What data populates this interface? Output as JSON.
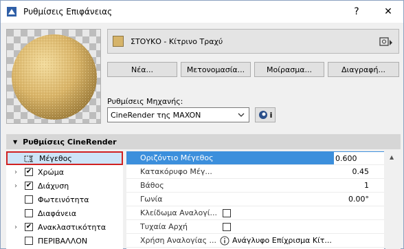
{
  "window": {
    "title": "Ρυθμίσεις Επιφάνειας",
    "help_label": "?",
    "close_label": "✕"
  },
  "material": {
    "name": "ΣΤΟΥΚΟ - Κίτρινο Τραχύ",
    "swatch_color": "#d6b46a"
  },
  "buttons": {
    "new": "Νέα...",
    "rename": "Μετονομασία...",
    "share": "Μοίρασμα...",
    "delete": "Διαγραφή..."
  },
  "engine": {
    "label": "Ρυθμίσεις Μηχανής:",
    "value": "CineRender της MAXON",
    "info_label": "i"
  },
  "section": {
    "title": "Ρυθμίσεις CineRender"
  },
  "channels": [
    {
      "label": "Μέγεθος",
      "checked": false,
      "expandable": false,
      "selected": true
    },
    {
      "label": "Χρώμα",
      "checked": true,
      "expandable": true
    },
    {
      "label": "Διάχυση",
      "checked": true,
      "expandable": true
    },
    {
      "label": "Φωτεινότητα",
      "checked": false,
      "expandable": false
    },
    {
      "label": "Διαφάνεια",
      "checked": false,
      "expandable": false
    },
    {
      "label": "Ανακλαστικότητα",
      "checked": true,
      "expandable": true
    },
    {
      "label": "ΠΕΡΙΒΑΛΛΟΝ",
      "checked": false,
      "expandable": false
    }
  ],
  "properties": [
    {
      "label": "Οριζόντιο Μέγεθος",
      "value": "0.600"
    },
    {
      "label": "Κατακόρυφο Μέγ...",
      "value": "0.45"
    },
    {
      "label": "Βάθος",
      "value": "1"
    },
    {
      "label": "Γωνία",
      "value": "0.00°"
    },
    {
      "label": "Κλείδωμα Αναλογί...",
      "value": ""
    },
    {
      "label": "Τυχαία Αρχή",
      "value": ""
    },
    {
      "label": "Χρήση Αναλογίας ...",
      "value": "Ανάγλυφο Επίχρισμα Κίτ..."
    }
  ],
  "colors": {
    "accent": "#3c8fdc",
    "selection_border": "#d02020",
    "tree_selected_bg": "#cde4f7"
  }
}
